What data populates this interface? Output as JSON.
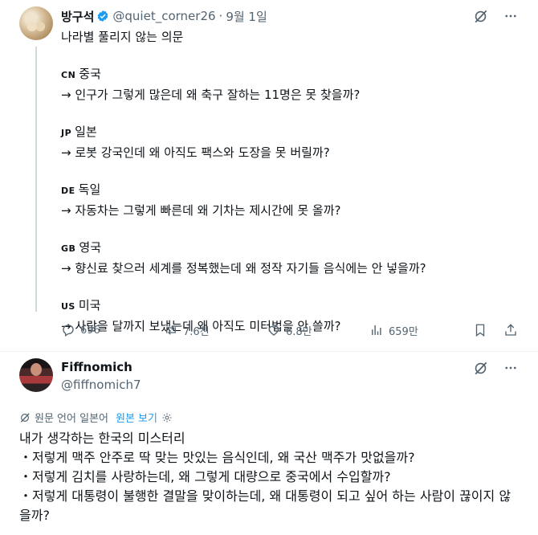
{
  "post1": {
    "author_name": "방구석",
    "handle": "@quiet_corner26",
    "dot": "·",
    "date": "9월 1일",
    "title": "나라별 풀리지 않는 의문",
    "sections": [
      {
        "code": "CN",
        "country": "중국",
        "line": "→ 인구가 그렇게 많은데 왜 축구 잘하는 11명은 못 찾을까?"
      },
      {
        "code": "JP",
        "country": "일본",
        "line": "→ 로봇 강국인데 왜 아직도 팩스와 도장을 못 버릴까?"
      },
      {
        "code": "DE",
        "country": "독일",
        "line": "→ 자동차는 그렇게 빠른데 왜 기차는 제시간에 못 올까?"
      },
      {
        "code": "GB",
        "country": "영국",
        "line": "→ 향신료 찾으러 세계를 정복했는데 왜 정작 자기들 음식에는 안 넣을까?"
      },
      {
        "code": "US",
        "country": "미국",
        "line": "→ 사람을 달까지 보냈는데 왜 아직도 미터법을 안 쓸까?"
      }
    ],
    "actions": {
      "replies": "696",
      "reposts": "7.6천",
      "likes": "6.8만",
      "views": "659만"
    },
    "icons": [
      "grok-icon",
      "more-icon",
      "reply-icon",
      "repost-icon",
      "like-icon",
      "views-icon",
      "bookmark-icon",
      "share-icon"
    ]
  },
  "post2": {
    "author_name": "Fiffnomich",
    "handle": "@fiffnomich7",
    "translate_note": "원문 언어 일본어",
    "translate_link": "원본 보기",
    "lines": [
      "내가 생각하는 한국의 미스터리",
      "・저렇게 맥주 안주로 딱 맞는 맛있는 음식인데, 왜 국산 맥주가 맛없을까?",
      "・저렇게 김치를 사랑하는데, 왜 그렇게 대량으로 중국에서 수입할까?",
      "・저렇게 대통령이 불행한 결말을 맞이하는데, 왜 대통령이 되고 싶어 하는 사람이 끊이지 않을까?"
    ]
  },
  "colors": {
    "text": "#0f1419",
    "muted": "#536471",
    "accent": "#1d9bf0",
    "border": "#eff3f4"
  }
}
